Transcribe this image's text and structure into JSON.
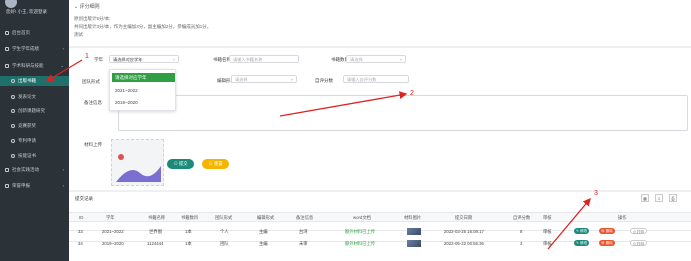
{
  "sidebar": {
    "user": "您好! 小王, 欢迎登录",
    "items": [
      {
        "label": "后台首页",
        "level": 1,
        "active": false,
        "arrow": ""
      },
      {
        "label": "学生学年成绩",
        "level": 1,
        "active": false,
        "arrow": "‹"
      },
      {
        "label": "学术科研与技能",
        "level": 1,
        "active": false,
        "arrow": "⌄"
      },
      {
        "label": "出版书籍",
        "level": 2,
        "active": true,
        "arrow": ""
      },
      {
        "label": "发表论文",
        "level": 2,
        "active": false,
        "arrow": ""
      },
      {
        "label": "创新课题研究",
        "level": 2,
        "active": false,
        "arrow": ""
      },
      {
        "label": "竞赛获奖",
        "level": 2,
        "active": false,
        "arrow": ""
      },
      {
        "label": "专利申请",
        "level": 2,
        "active": false,
        "arrow": ""
      },
      {
        "label": "技能证书",
        "level": 2,
        "active": false,
        "arrow": ""
      },
      {
        "label": "社会实践活动",
        "level": 1,
        "active": false,
        "arrow": "‹"
      },
      {
        "label": "荣誉申报",
        "level": 1,
        "active": false,
        "arrow": "‹"
      }
    ]
  },
  "rules": {
    "title": "评分细则",
    "lines": [
      "原创出版计5分/本;",
      "共同出版计3分/本，作为主编加3分，副主编加2分，参编成员加1分。",
      "测试"
    ]
  },
  "form": {
    "year_label": "学年",
    "year_value": "请选择对应学年",
    "year_options": [
      "请选择对应学年",
      "2021~2022",
      "2019~2020"
    ],
    "book_name_label": "书籍名称",
    "book_name_placeholder": "请输入书籍名称",
    "book_count_label": "书籍数目",
    "book_count_placeholder": "请选择",
    "team_label": "团队形式",
    "edit_label": "编辑形式",
    "edit_placeholder": "请选择",
    "self_score_label": "自评分数",
    "self_score_placeholder": "请输入自评分数",
    "remark_label": "备注信息",
    "remark_placeholder": "请输入",
    "upload_label": "材料上传",
    "submit_label": "提交",
    "reset_label": "重置"
  },
  "records": {
    "title": "提交记录",
    "columns": [
      "ID",
      "学年",
      "书籍名称",
      "书籍数目",
      "团队形式",
      "编辑形式",
      "备注信息",
      "word文档",
      "材料图片",
      "提交日期",
      "自评分数",
      "审核",
      "操作"
    ],
    "rows": [
      {
        "id": "33",
        "year": "2021~2022",
        "name": "世界图",
        "count": "1本",
        "team": "个人",
        "edit": "主编",
        "remark": "台湾",
        "doc": "额外材料已上传",
        "date": "2022-03-25 16:08:17",
        "score": "8",
        "review": "审核"
      },
      {
        "id": "34",
        "year": "2019~2020",
        "name": "1124444",
        "count": "1本",
        "team": "团队",
        "edit": "主编",
        "remark": "未审",
        "doc": "额外材料已上传",
        "date": "2022-05-22 00:55:36",
        "score": "3",
        "review": "审核"
      }
    ],
    "actions": {
      "edit": "修改",
      "delete": "删除",
      "print": "打印"
    }
  },
  "annotations": {
    "n1": "1",
    "n2": "2",
    "n3": "3"
  },
  "colors": {
    "sidebar": "#2b3238",
    "accent": "#1a8a7a",
    "warning": "#f5b400",
    "danger": "#e8552a",
    "annotation": "#dd2222"
  }
}
